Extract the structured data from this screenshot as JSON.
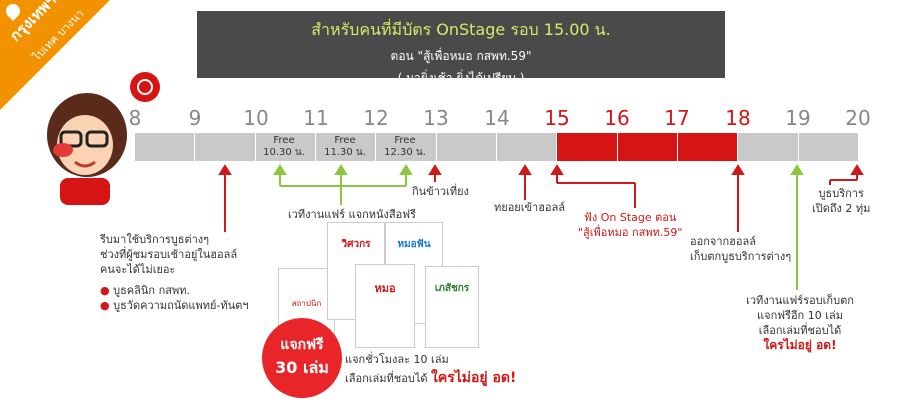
{
  "badge": {
    "line1": "กรุงเทพฯ",
    "line2": "ไบเทค บางนา"
  },
  "banner": {
    "line1": "สำหรับคนที่มีบัตร OnStage รอบ 15.00 น.",
    "line2": "ตอน \"สู้เพื่อหมอ กสพท.59\"",
    "line3": "( มายิ่งเช้า ยิ่งได้เปรียบ )"
  },
  "hours": [
    "8",
    "9",
    "10",
    "11",
    "12",
    "13",
    "14",
    "15",
    "16",
    "17",
    "18",
    "19",
    "20"
  ],
  "free_slots": [
    {
      "label": "Free",
      "time": "10.30 น."
    },
    {
      "label": "Free",
      "time": "11.30 น."
    },
    {
      "label": "Free",
      "time": "12.30 น."
    }
  ],
  "notes": {
    "morning": [
      "รีบมาใช้บริการบูธต่างๆ",
      "ช่วงที่ผู้ชมรอบเช้าอยู่ในฮอลล์",
      "คนจะได้ไม่เยอะ"
    ],
    "morning_bullets": [
      "บูธคลินิก กสพท.",
      "บูธวัดความถนัดแพทย์-ทันตฯ"
    ],
    "free_books": "เวทีงานแฟร์ แจกหนังสือฟรี",
    "lunch": "กินข้าวเที่ยง",
    "enter_hall": "ทยอยเข้าฮอลล์",
    "onstage": [
      "ฟัง On Stage ตอน",
      "\"สู้เพื่อหมอ กสพท.59\""
    ],
    "leave_hall": [
      "ออกจากฮอลล์",
      "เก็บตกบูธบริการต่างๆ"
    ],
    "service_until": [
      "บูธบริการ",
      "เปิดถึง 2 ทุ่ม"
    ],
    "collect": [
      "เวทีงานแฟร์รอบเก็บตก",
      "แจกฟรีอีก 10 เล่ม",
      "เลือกเล่มที่ชอบได้"
    ],
    "collect_red": "ใครไม่อยู่ อด!",
    "giveaway_free": "แจกฟรี",
    "giveaway_count": "30 เล่ม",
    "giveaway_line1": "แจกชั่วโมงละ 10 เล่ม",
    "giveaway_line2": "เลือกเล่มที่ชอบได้",
    "giveaway_red": "ใครไม่อยู่ อด!"
  },
  "books": [
    {
      "title": "วิศวกร"
    },
    {
      "title": "หมอฟัน"
    },
    {
      "title": "หมอ"
    },
    {
      "title": "เภสัชกร"
    },
    {
      "title": "สถาปนิก"
    }
  ],
  "colors": {
    "accent_red": "#d01818",
    "badge_orange": "#f39200",
    "timeline_gray": "#c9c9c9",
    "arrow_green": "#8cc63f"
  }
}
